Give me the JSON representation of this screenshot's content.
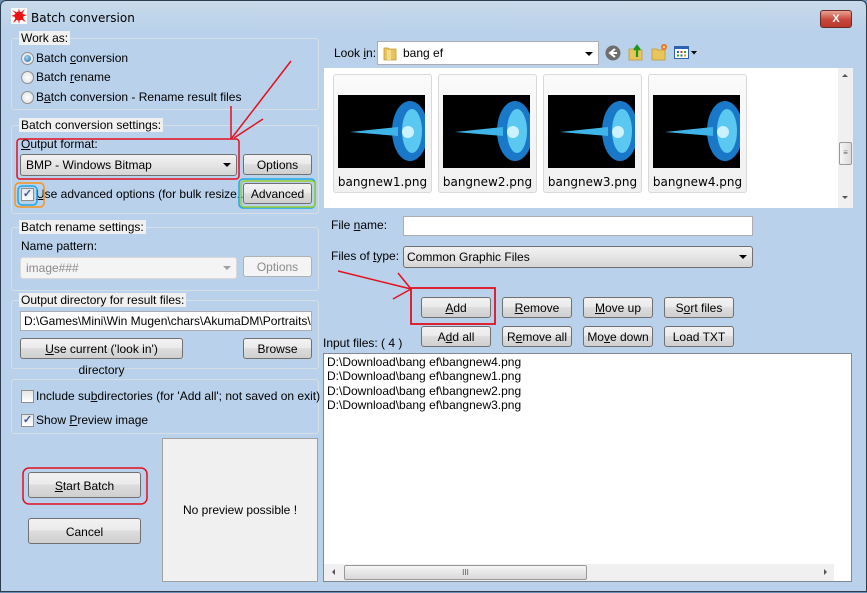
{
  "window": {
    "title": "Batch conversion",
    "close_label": "X"
  },
  "work_as": {
    "label": "Work as:",
    "options": [
      {
        "pre": "Batch ",
        "u": "c",
        "post": "onversion",
        "selected": true
      },
      {
        "pre": "Batch ",
        "u": "r",
        "post": "ename",
        "selected": false
      },
      {
        "pre": "B",
        "u": "a",
        "post": "tch conversion - Rename result files",
        "selected": false
      }
    ]
  },
  "conversion_settings": {
    "label": "Batch conversion settings:",
    "output_format_label_u": "O",
    "output_format_label_rest": "utput format:",
    "output_format_value": "BMP - Windows Bitmap",
    "options_button": "Options",
    "advanced_checkbox_u": "U",
    "advanced_checkbox_rest": "se advanced options (for bulk resize...)",
    "advanced_checked": true,
    "advanced_button": "Advanced"
  },
  "rename_settings": {
    "label": "Batch rename settings:",
    "name_pattern_label": "Name pattern:",
    "name_pattern_value": "image###",
    "options_button": "Options"
  },
  "output_dir": {
    "label": "Output directory for result files:",
    "value": "D:\\Games\\Mini\\Win Mugen\\chars\\AkumaDM\\Portraits\\",
    "use_current_u": "U",
    "use_current_rest": "se current ('look in') directory",
    "browse_button": "Browse"
  },
  "misc": {
    "include_subdirs_pre": "Include su",
    "include_subdirs_u": "b",
    "include_subdirs_post": "directories (for 'Add all'; not saved on exit)",
    "include_subdirs_checked": false,
    "show_preview_pre": "Show ",
    "show_preview_u": "P",
    "show_preview_post": "review image",
    "show_preview_checked": true
  },
  "actions": {
    "start_u": "S",
    "start_rest": "tart Batch",
    "cancel": "Cancel"
  },
  "preview": {
    "text": "No preview possible !"
  },
  "browser": {
    "look_in_pre": "Look ",
    "look_in_u": "i",
    "look_in_post": "n:",
    "folder": "bang ef",
    "icons": [
      "back-icon",
      "up-folder-icon",
      "new-folder-icon",
      "view-menu-icon"
    ],
    "thumbnails": [
      {
        "name": "bangnew1.png"
      },
      {
        "name": "bangnew2.png"
      },
      {
        "name": "bangnew3.png"
      },
      {
        "name": "bangnew4.png"
      }
    ],
    "file_name_pre": "File ",
    "file_name_u": "n",
    "file_name_post": "ame:",
    "file_name_value": "",
    "files_of_type_pre": "Files of ",
    "files_of_type_u": "t",
    "files_of_type_post": "ype:",
    "files_of_type_value": "Common Graphic Files"
  },
  "list_buttons": {
    "add": {
      "pre": "",
      "u": "A",
      "post": "dd"
    },
    "remove": {
      "pre": "",
      "u": "R",
      "post": "emove"
    },
    "move_up": {
      "pre": "",
      "u": "M",
      "post": "ove up"
    },
    "sort": {
      "pre": "S",
      "u": "o",
      "post": "rt files"
    },
    "add_all": {
      "pre": "A",
      "u": "d",
      "post": "d all"
    },
    "remove_all": {
      "pre": "R",
      "u": "e",
      "post": "move all"
    },
    "move_down": {
      "pre": "Mo",
      "u": "v",
      "post": "e down"
    },
    "load_txt": {
      "pre": "Load TXT",
      "u": "",
      "post": ""
    }
  },
  "input_files": {
    "label": "Input files: ( 4 )",
    "items": [
      "D:\\Download\\bang ef\\bangnew4.png",
      "D:\\Download\\bang ef\\bangnew1.png",
      "D:\\Download\\bang ef\\bangnew2.png",
      "D:\\Download\\bang ef\\bangnew3.png"
    ],
    "scrollbar_grip": "III"
  },
  "colors": {
    "annotation_red": "#e3101e",
    "annotation_orange": "#f7941d",
    "annotation_cyan": "#1ca9e6",
    "annotation_lime": "#9acd32"
  }
}
